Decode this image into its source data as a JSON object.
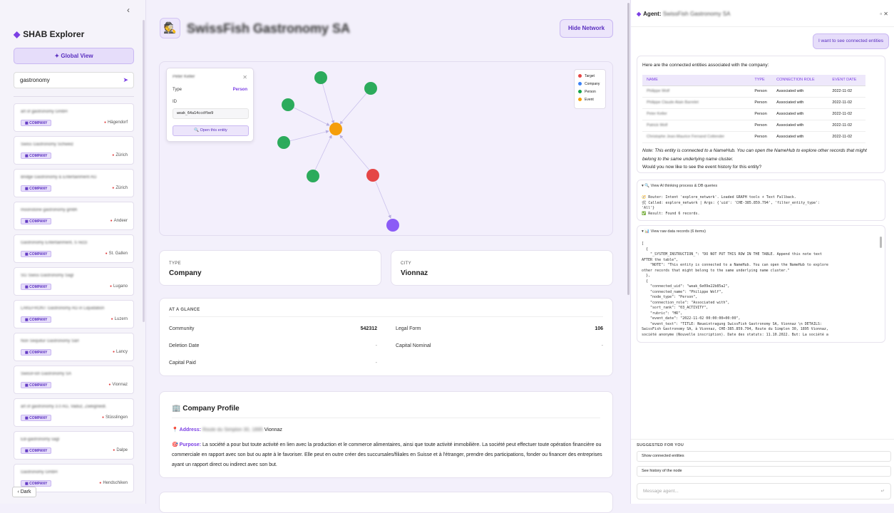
{
  "sidebar": {
    "brand": "SHAB Explorer",
    "global_view": "✦ Global View",
    "search_value": "gastronomy",
    "dark_label": "Dark",
    "items": [
      {
        "name": "art of gastronomy GmbH",
        "badge": "COMPANY",
        "city": "Hägendorf"
      },
      {
        "name": "Swiss Gastronomy Schweiz",
        "badge": "COMPANY",
        "city": "Zürich"
      },
      {
        "name": "Bridge Gastronomy & Entertainment AG",
        "badge": "COMPANY",
        "city": "Zürich"
      },
      {
        "name": "moonstone gastronomy gmbh",
        "badge": "COMPANY",
        "city": "Andeer"
      },
      {
        "name": "Gastronomy Entertainment, S rezzi",
        "badge": "COMPANY",
        "city": "St. Gallen"
      },
      {
        "name": "SG Swiss Gastronomy Sagl",
        "badge": "COMPANY",
        "city": "Lugano"
      },
      {
        "name": "LAKEFRONT Gastronomy AG in Liquidation",
        "badge": "COMPANY",
        "city": "Luzern"
      },
      {
        "name": "Non Sequitur Gastronomy Sàrl",
        "badge": "COMPANY",
        "city": "Lancy"
      },
      {
        "name": "SwissFish Gastronomy SA",
        "badge": "COMPANY",
        "city": "Vionnaz"
      },
      {
        "name": "art of gastronomy 3.0 AG, Vaduz, Zweigniedl.",
        "badge": "COMPANY",
        "city": "Stüsslingen"
      },
      {
        "name": "EB-gastronomy sagl",
        "badge": "COMPANY",
        "city": "Dalpe"
      },
      {
        "name": "Gastronomy GmbH",
        "badge": "COMPANY",
        "city": "Hendschiken"
      }
    ]
  },
  "main": {
    "title": "SwissFish Gastronomy SA",
    "hide_network": "Hide Network",
    "popup": {
      "name": "Peter Keller",
      "type_label": "Type",
      "type_value": "Person",
      "id_label": "ID",
      "id_value": "weak_64a14ccdfbe9",
      "open_label": "🔍 Open this entity"
    },
    "legend": [
      {
        "label": "Target",
        "color": "#e54646"
      },
      {
        "label": "Company",
        "color": "#3b82f6"
      },
      {
        "label": "Person",
        "color": "#16a34a"
      },
      {
        "label": "Event",
        "color": "#f59e0b"
      }
    ],
    "type_card": {
      "label": "TYPE",
      "value": "Company"
    },
    "city_card": {
      "label": "CITY",
      "value": "Vionnaz"
    },
    "glance": {
      "title": "AT A GLANCE",
      "community_label": "Community",
      "community_value": "542312",
      "legal_form_label": "Legal Form",
      "legal_form_value": "106",
      "deletion_label": "Deletion Date",
      "deletion_value": "-",
      "capital_nominal_label": "Capital Nominal",
      "capital_nominal_value": "-",
      "capital_paid_label": "Capital Paid",
      "capital_paid_value": "-"
    },
    "profile": {
      "title": "🏢 Company Profile",
      "address_label": "Address:",
      "address_blurred": "Route du Simplon 30, 1895",
      "address_city": "Vionnaz",
      "purpose_label": "Purpose:",
      "purpose_text": "La société a pour but toute activité en lien avec la production et le commerce alimentaires, ainsi que toute activité immobilière. La société peut effectuer toute opération financière ou commerciale en rapport avec son but ou apte à le favoriser. Elle peut en outre créer des succursales/filiales en Suisse et à l'étranger, prendre des participations, fonder ou financer des entreprises ayant un rapport direct ou indirect avec son but."
    }
  },
  "agent": {
    "title_prefix": "Agent:",
    "title_name": "SwissFish Gastronomy SA",
    "user_message": "I want to see connected entities",
    "intro": "Here are the connected entities associated with the company:",
    "columns": [
      "NAME",
      "TYPE",
      "CONNECTION ROLE",
      "EVENT DATE"
    ],
    "rows": [
      [
        "Philippe Wolf",
        "Person",
        "Associated with",
        "2022-11-02"
      ],
      [
        "Philippe Claude Alain Barrelet",
        "Person",
        "Associated with",
        "2022-11-02"
      ],
      [
        "Peter Keller",
        "Person",
        "Associated with",
        "2022-11-02"
      ],
      [
        "Patrick Wolf",
        "Person",
        "Associated with",
        "2022-11-02"
      ],
      [
        "Christophe Jean-Maurice Fernand Cottender",
        "Person",
        "Associated with",
        "2022-11-02"
      ]
    ],
    "note": "Note: This entity is connected to a NameHub. You can open the NameHub to explore other records that might belong to the same underlying name cluster.",
    "question": "Would you now like to see the event history for this entity?",
    "thinking_title": "▾ 🔍 View AI thinking process & DB queries",
    "thinking_lines": "🧭 Router: Intent 'explore_network'. Loaded GRAPH tools + Text Fallback.\n🛠 Called: explore_network | Args: {'uid': 'CHE-385.859.794', 'filter_entity_type':\n'All'}\n✅ Result: Found 6 records.",
    "raw_title": "▾ 📊 View raw data records (6 items)",
    "raw_lines": "[\n  {\n    \"_SYSTEM_INSTRUCTION_\": \"DO NOT PUT THIS ROW IN THE TABLE. Append this note text\nAFTER the table\",\n    \"NOTE\": \"This entity is connected to a NameHub. You can open the NameHub to explore\nother records that might belong to the same underlying name cluster.\"\n  },\n  {\n    \"connected_uid\": \"weak_6e09e22b85a2\",\n    \"connected_name\": \"Philippe Wolf\",\n    \"node_type\": \"Person\",\n    \"connection_role\": \"Associated with\",\n    \"sort_rank\": \"03_ACTIVITY\",\n    \"rubric\": \"HR\",\n    \"event_date\": \"2022-11-02 00:00:00+00:00\",\n    \"event_text\": \"TITLE: Neueintragung SwissFish Gastronomy SA, Vionnaz \\n DETAILS:\nSwissFish Gastronomy SA, à Vionnaz, CHE-385.859.794, Route du Simplon 30, 1895 Vionnaz,\nsociété anonyme (Nouvelle inscription). Date des statuts: 11.10.2022. But: La société a",
    "suggested_title": "SUGGESTED FOR YOU",
    "suggestions": [
      "Show connected entities",
      "See history of the node"
    ],
    "input_placeholder": "Message agent..."
  }
}
